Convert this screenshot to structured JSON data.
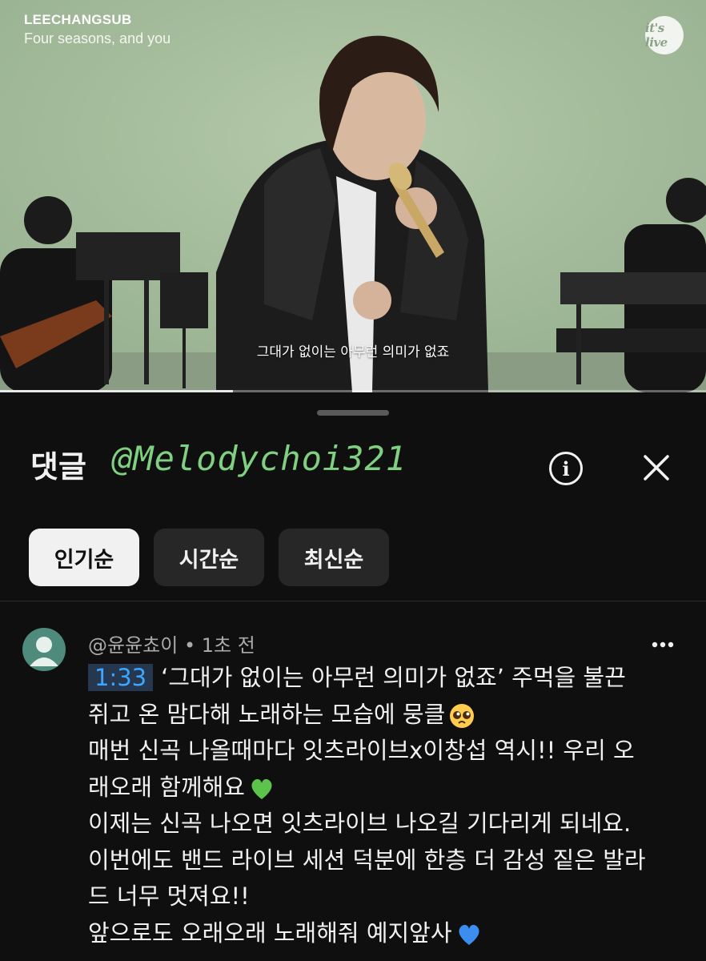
{
  "video": {
    "artist": "LEECHANGSUB",
    "song_title": "Four seasons, and you",
    "logo_text": "it's live",
    "subtitle": "그대가 없이는 아무런 의미가 없죠",
    "progress_fraction": 0.33,
    "background_color": "#a9bf9f"
  },
  "comments_panel": {
    "title": "댓글",
    "handle_overlay": "@Melodychoi321",
    "handle_overlay_color": "#7fd081",
    "info_icon": "info-icon",
    "close_icon": "close-icon",
    "sort_chips": [
      {
        "label": "인기순",
        "active": true
      },
      {
        "label": "시간순",
        "active": false
      },
      {
        "label": "최신순",
        "active": false
      }
    ]
  },
  "comment": {
    "author": "@윤윤쵸이",
    "separator": "•",
    "time_ago": "1초 전",
    "timestamp_link": "1:33",
    "lines": [
      "‘그대가 없이는 아무런 의미가 없죠’ 주먹을 불끈",
      "쥐고 온 맘다해 노래하는 모습에 뭉클",
      "매번 신곡 나올때마다 잇츠라이브x이창섭 역시!! 우리 오",
      "래오래 함께해요",
      "이제는 신곡 나오면 잇츠라이브 나오길 기다리게 되네요.",
      "이번에도 밴드 라이브 세션 덕분에 한층 더 감성 짙은 발라",
      "드 너무 멋져요!!",
      "앞으로도 오래오래 노래해줘 예지앞사"
    ],
    "emojis": [
      "pleading-face-emoji",
      "green-heart-emoji",
      "blue-heart-emoji"
    ],
    "link_color": "#3ea6ff",
    "more_icon": "more-vertical-icon"
  }
}
